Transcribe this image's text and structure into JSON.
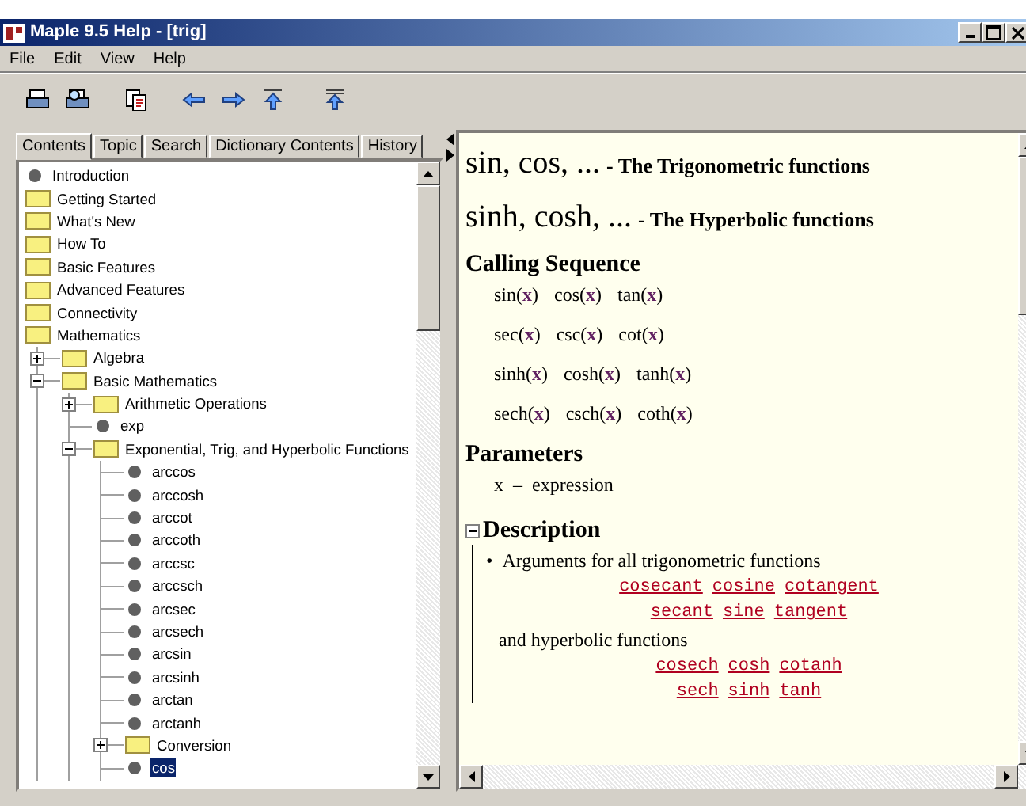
{
  "window": {
    "title": "Maple 9.5 Help - [trig]"
  },
  "menu": [
    "File",
    "Edit",
    "View",
    "Help"
  ],
  "toolbar": [
    {
      "kind": "print"
    },
    {
      "kind": "preview"
    },
    {
      "kind": "copy"
    },
    {
      "kind": "back"
    },
    {
      "kind": "forward"
    },
    {
      "kind": "up"
    },
    {
      "kind": "top"
    }
  ],
  "tabs": [
    {
      "label": "Contents",
      "selected": true
    },
    {
      "label": "Topic",
      "selected": false
    },
    {
      "label": "Search",
      "selected": false
    },
    {
      "label": "Dictionary Contents",
      "selected": false
    },
    {
      "label": "History",
      "selected": false
    }
  ],
  "tree": [
    {
      "label": "Introduction",
      "kind": "topic",
      "selected": false
    },
    {
      "label": "Getting Started",
      "kind": "folder",
      "selected": false
    },
    {
      "label": "What's New",
      "kind": "folder",
      "selected": false
    },
    {
      "label": "How To",
      "kind": "folder",
      "selected": false
    },
    {
      "label": "Basic Features",
      "kind": "folder",
      "selected": false
    },
    {
      "label": "Advanced Features",
      "kind": "folder",
      "selected": false
    },
    {
      "label": "Connectivity",
      "kind": "folder",
      "selected": false
    },
    {
      "label": "Mathematics",
      "kind": "folder",
      "selected": false,
      "children": [
        {
          "label": "Algebra",
          "kind": "folder",
          "expanded": false,
          "selected": false
        },
        {
          "label": "Basic Mathematics",
          "kind": "folder",
          "expanded": true,
          "selected": false,
          "children": [
            {
              "label": "Arithmetic Operations",
              "kind": "folder",
              "expanded": false,
              "selected": false
            },
            {
              "label": "exp",
              "kind": "topic",
              "selected": false
            },
            {
              "label": "Exponential, Trig, and Hyperbolic Functions",
              "kind": "folder",
              "expanded": true,
              "selected": false,
              "children": [
                {
                  "label": "arccos",
                  "kind": "topic",
                  "selected": false
                },
                {
                  "label": "arccosh",
                  "kind": "topic",
                  "selected": false
                },
                {
                  "label": "arccot",
                  "kind": "topic",
                  "selected": false
                },
                {
                  "label": "arccoth",
                  "kind": "topic",
                  "selected": false
                },
                {
                  "label": "arccsc",
                  "kind": "topic",
                  "selected": false
                },
                {
                  "label": "arccsch",
                  "kind": "topic",
                  "selected": false
                },
                {
                  "label": "arcsec",
                  "kind": "topic",
                  "selected": false
                },
                {
                  "label": "arcsech",
                  "kind": "topic",
                  "selected": false
                },
                {
                  "label": "arcsin",
                  "kind": "topic",
                  "selected": false
                },
                {
                  "label": "arcsinh",
                  "kind": "topic",
                  "selected": false
                },
                {
                  "label": "arctan",
                  "kind": "topic",
                  "selected": false
                },
                {
                  "label": "arctanh",
                  "kind": "topic",
                  "selected": false
                },
                {
                  "label": "Conversion",
                  "kind": "folder",
                  "expanded": false,
                  "selected": false
                },
                {
                  "label": "cos",
                  "kind": "topic",
                  "selected": true
                }
              ]
            }
          ]
        }
      ]
    }
  ],
  "page": {
    "headings": [
      {
        "name": "sin, cos, ...",
        "desc": "- The Trigonometric functions"
      },
      {
        "name": "sinh, cosh, ...",
        "desc": "- The Hyperbolic functions"
      }
    ],
    "calling_sequence": {
      "title": "Calling Sequence",
      "rows": [
        [
          "sin(**x**)",
          "cos(**x**)",
          "tan(**x**)"
        ],
        [
          "sec(**x**)",
          "csc(**x**)",
          "cot(**x**)"
        ],
        [
          "sinh(**x**)",
          "cosh(**x**)",
          "tanh(**x**)"
        ],
        [
          "sech(**x**)",
          "csch(**x**)",
          "coth(**x**)"
        ]
      ]
    },
    "parameters": {
      "title": "Parameters",
      "items": [
        "x  –  expression"
      ]
    },
    "description": {
      "title": "Description",
      "expanded": true,
      "bullet": "•",
      "blocks": [
        {
          "kind": "text",
          "text": "Arguments for all trigonometric functions",
          "bulleted": true
        },
        {
          "kind": "links",
          "links": [
            "cosecant",
            "cosine",
            "cotangent"
          ]
        },
        {
          "kind": "links",
          "links": [
            "secant",
            "sine",
            "tangent"
          ]
        },
        {
          "kind": "text",
          "text": "and hyperbolic functions",
          "bulleted": false
        },
        {
          "kind": "links",
          "links": [
            "cosech",
            "cosh",
            "cotanh"
          ]
        },
        {
          "kind": "links",
          "links": [
            "sech",
            "sinh",
            "tanh"
          ]
        }
      ]
    }
  }
}
